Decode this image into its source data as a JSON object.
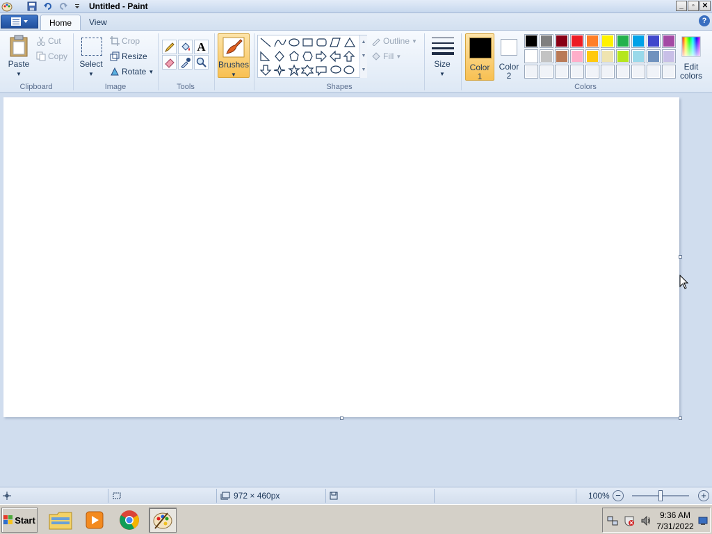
{
  "window": {
    "title": "Untitled - Paint"
  },
  "tabs": [
    {
      "label": "Home",
      "active": true
    },
    {
      "label": "View",
      "active": false
    }
  ],
  "ribbon": {
    "clipboard": {
      "paste": "Paste",
      "cut": "Cut",
      "copy": "Copy",
      "group": "Clipboard"
    },
    "image": {
      "select": "Select",
      "crop": "Crop",
      "resize": "Resize",
      "rotate": "Rotate",
      "group": "Image"
    },
    "tools": {
      "group": "Tools"
    },
    "brushes": {
      "label": "Brushes"
    },
    "shapes": {
      "outline": "Outline",
      "fill": "Fill",
      "group": "Shapes"
    },
    "size": {
      "label": "Size"
    },
    "colors": {
      "color1_line1": "Color",
      "color1_line2": "1",
      "color2_line1": "Color",
      "color2_line2": "2",
      "edit_line1": "Edit",
      "edit_line2": "colors",
      "group": "Colors",
      "color1_value": "#000000",
      "color2_value": "#ffffff",
      "palette_row1": [
        "#000000",
        "#7f7f7f",
        "#880015",
        "#ed1c24",
        "#ff7f27",
        "#fff200",
        "#22b14c",
        "#00a2e8",
        "#3f48cc",
        "#a349a4"
      ],
      "palette_row2": [
        "#ffffff",
        "#c3c3c3",
        "#b97a57",
        "#ffaec9",
        "#ffc90e",
        "#efe4b0",
        "#b5e61d",
        "#99d9ea",
        "#7092be",
        "#c8bfe7"
      ],
      "palette_row3": [
        "",
        "",
        "",
        "",
        "",
        "",
        "",
        "",
        "",
        ""
      ]
    }
  },
  "status": {
    "canvas_size": "972 × 460px",
    "zoom": "100%",
    "zoom_fraction": 0.5
  },
  "taskbar": {
    "start": "Start",
    "time": "9:36 AM",
    "date": "7/31/2022"
  }
}
